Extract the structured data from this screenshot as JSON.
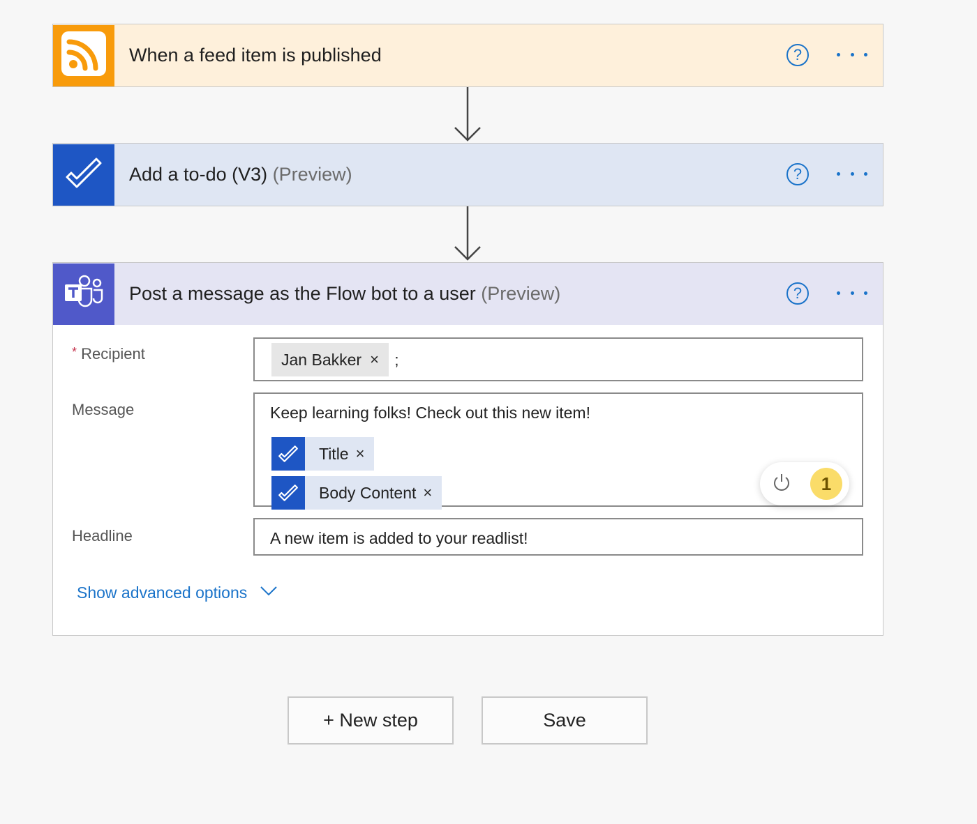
{
  "steps": {
    "trigger": {
      "title": "When a feed item is published",
      "icon": "rss-icon",
      "color": "#f89b0b",
      "header_bg": "#fef0db"
    },
    "todo": {
      "title": "Add a to-do (V3)",
      "suffix": "(Preview)",
      "icon": "todo-check-icon",
      "color": "#1e56c4",
      "header_bg": "#dfe6f3"
    },
    "teams": {
      "title": "Post a message as the Flow bot to a user",
      "suffix": "(Preview)",
      "icon": "teams-icon",
      "color": "#5059c9",
      "header_bg": "#e4e4f3",
      "fields": {
        "recipient": {
          "required_mark": "*",
          "label": "Recipient",
          "chip": "Jan Bakker",
          "separator": ";"
        },
        "message": {
          "label": "Message",
          "text": "Keep learning folks! Check out this new item!",
          "tokens": [
            "Title",
            "Body Content"
          ],
          "badge_count": "1"
        },
        "headline": {
          "label": "Headline",
          "value": "A new item is added to your readlist!"
        }
      },
      "advanced_label": "Show advanced options"
    }
  },
  "common": {
    "help_glyph": "?",
    "close_glyph": "×"
  },
  "buttons": {
    "new_step": "+ New step",
    "save": "Save"
  },
  "colors": {
    "accent": "#1a73c9",
    "required": "#c4314b",
    "badge": "#fadc69"
  }
}
